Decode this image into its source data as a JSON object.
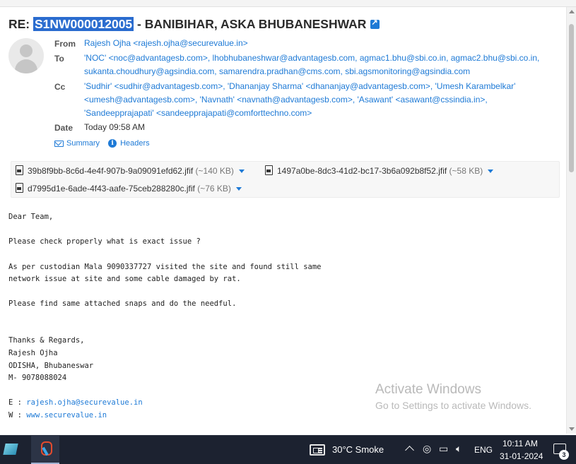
{
  "subject": {
    "prefix": "RE: ",
    "ticket": "S1NW000012005",
    "rest": " - BANIBIHAR, ASKA BHUBANESHWAR"
  },
  "headers": {
    "from_label": "From",
    "from_value": "Rajesh Ojha <rajesh.ojha@securevalue.in>",
    "to_label": "To",
    "to_line1": "'NOC' <noc@advantagesb.com>, lhobhubaneshwar@advantagesb.com, agmac1.bhu@sbi.co.in, agmac2.bhu@sbi.co.in,",
    "to_line2": "sukanta.choudhury@agsindia.com, samarendra.pradhan@cms.com, sbi.agsmonitoring@agsindia.com",
    "cc_label": "Cc",
    "cc_line1": "'Sudhir' <sudhir@advantagesb.com>, 'Dhananjay Sharma' <dhananjay@advantagesb.com>, 'Umesh Karambelkar'",
    "cc_line2": "<umesh@advantagesb.com>, 'Navnath' <navnath@advantagesb.com>, 'Asawant' <asawant@cssindia.in>,",
    "cc_line3": "'Sandeepprajapati' <sandeepprajapati@comforttechno.com>",
    "date_label": "Date",
    "date_value": "Today 09:58 AM",
    "summary_link": "Summary",
    "headers_link": "Headers"
  },
  "attachments": [
    {
      "name": "39b8f9bb-8c6d-4e4f-907b-9a09091efd62.jfif",
      "size": "(~140 KB)"
    },
    {
      "name": "1497a0be-8dc3-41d2-bc17-3b6a092b8f52.jfif",
      "size": "(~58 KB)"
    },
    {
      "name": "d7995d1e-6ade-4f43-aafe-75ceb288280c.jfif",
      "size": "(~76 KB)"
    }
  ],
  "body": {
    "greeting": "Dear Team,",
    "line1": "Please check properly what is exact issue ?",
    "line2": "As per custodian Mala 9090337727 visited the site and found still same",
    "line3": "network issue at site and some cable damaged by rat.",
    "line4": "Please find same attached snaps and do the needful.",
    "sig1": "Thanks & Regards,",
    "sig2": "Rajesh Ojha",
    "sig3": "ODISHA, Bhubaneswar",
    "sig4": "M- 9078088024",
    "email_prefix": "E : ",
    "email": "rajesh.ojha@securevalue.in",
    "web_prefix": "W : ",
    "web": "www.securevalue.in"
  },
  "watermark": {
    "line1": "Activate Windows",
    "line2": "Go to Settings to activate Windows."
  },
  "taskbar": {
    "weather": "30°C  Smoke",
    "language": "ENG",
    "time": "10:11 AM",
    "date": "31-01-2024",
    "notification_count": "3"
  },
  "colors": {
    "link": "#1e7ad6",
    "highlight": "#2a6ccf",
    "taskbar": "#1c2230"
  }
}
